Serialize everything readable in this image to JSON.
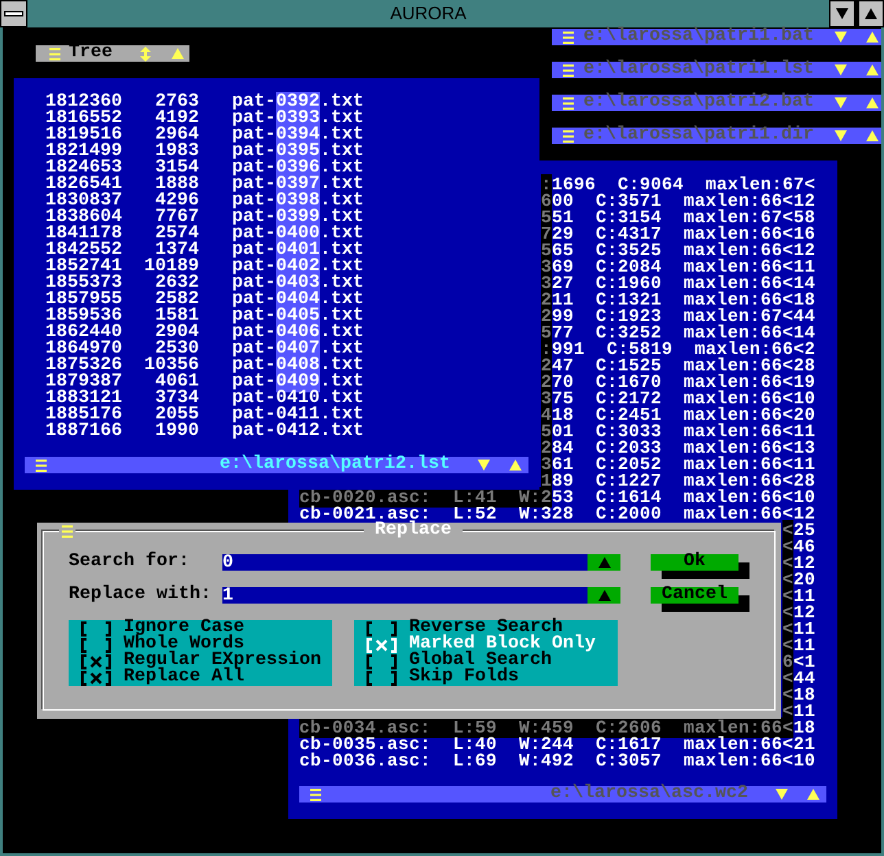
{
  "window": {
    "title": "AURORA"
  },
  "tree_icon": {
    "title": "Tree"
  },
  "minimized_windows": [
    {
      "path": "e:\\larossa\\patri1.bat"
    },
    {
      "path": "e:\\larossa\\patri1.lst"
    },
    {
      "path": "e:\\larossa\\patri2.bat"
    },
    {
      "path": "e:\\larossa\\patri1.dir"
    }
  ],
  "stats_window": {
    "path": "e:\\larossa\\asc.wc2",
    "active": false,
    "rows": [
      {
        "shaded": ":",
        "text": "1696  C:9064  maxlen:67<"
      },
      {
        "shaded": "6",
        "text": "00  C:3571  maxlen:66<12"
      },
      {
        "shaded": "5",
        "text": "51  C:3154  maxlen:67<58"
      },
      {
        "shaded": "7",
        "text": "29  C:4317  maxlen:66<16"
      },
      {
        "shaded": "5",
        "text": "65  C:3525  maxlen:66<12"
      },
      {
        "shaded": "3",
        "text": "69  C:2084  maxlen:66<11"
      },
      {
        "shaded": "3",
        "text": "27  C:1960  maxlen:66<14"
      },
      {
        "shaded": "2",
        "text": "11  C:1321  maxlen:66<18"
      },
      {
        "shaded": "2",
        "text": "99  C:1923  maxlen:67<44"
      },
      {
        "shaded": "5",
        "text": "77  C:3252  maxlen:66<14"
      },
      {
        "shaded": ":",
        "text": "991  C:5819  maxlen:66<2"
      },
      {
        "shaded": "2",
        "text": "47  C:1525  maxlen:66<28"
      },
      {
        "shaded": "2",
        "text": "70  C:1670  maxlen:66<19"
      },
      {
        "shaded": "3",
        "text": "75  C:2172  maxlen:66<10"
      },
      {
        "shaded": "4",
        "text": "18  C:2451  maxlen:66<20"
      },
      {
        "shaded": "5",
        "text": "01  C:3033  maxlen:66<11"
      },
      {
        "shaded": "2",
        "text": "84  C:2033  maxlen:66<13"
      },
      {
        "shaded": "3",
        "text": "61  C:2052  maxlen:66<11"
      },
      {
        "shaded": "1",
        "text": "89  C:1227  maxlen:66<28"
      },
      {
        "shaded": "cb-0020.asc:  L:41  W:2",
        "text": "53  C:1614  maxlen:66<10"
      },
      {
        "text": "cb-0021.asc:  L:52  W:328  C:2000  maxlen:66<12"
      },
      {
        "shaded": "<",
        "text": "25"
      },
      {
        "shaded": "<",
        "text": "46"
      },
      {
        "shaded": "<",
        "text": "12"
      },
      {
        "shaded": "<",
        "text": "20"
      },
      {
        "shaded": "<",
        "text": "11"
      },
      {
        "shaded": "<",
        "text": "12"
      },
      {
        "shaded": "<",
        "text": "11"
      },
      {
        "shaded": "<",
        "text": "11"
      },
      {
        "shaded": "6",
        "text": "<1"
      },
      {
        "shaded": "<",
        "text": "44"
      },
      {
        "shaded": "<",
        "text": "18"
      },
      {
        "shaded": "<",
        "text": "11"
      },
      {
        "shaded": "cb-0034.asc:  L:59  W:459  C:2606  maxlen:66<",
        "text": "18"
      },
      {
        "text": "cb-0035.asc:  L:40  W:244  C:1617  maxlen:66<21"
      },
      {
        "text": "cb-0036.asc:  L:69  W:492  C:3057  maxlen:66<10"
      }
    ]
  },
  "list_window": {
    "path": "e:\\larossa\\patri2.lst",
    "active": true,
    "rows": [
      {
        "number": "1812360",
        "size": "2763",
        "name": [
          "pat-",
          "0392",
          ".txt"
        ],
        "selected": true
      },
      {
        "number": "1816552",
        "size": "4192",
        "name": [
          "pat-",
          "0393",
          ".txt"
        ],
        "selected": true
      },
      {
        "number": "1819516",
        "size": "2964",
        "name": [
          "pat-",
          "0394",
          ".txt"
        ],
        "selected": true
      },
      {
        "number": "1821499",
        "size": "1983",
        "name": [
          "pat-",
          "0395",
          ".txt"
        ],
        "selected": true
      },
      {
        "number": "1824653",
        "size": "3154",
        "name": [
          "pat-",
          "0396",
          ".txt"
        ],
        "selected": true
      },
      {
        "number": "1826541",
        "size": "1888",
        "name": [
          "pat-",
          "0397",
          ".txt"
        ],
        "selected": true
      },
      {
        "number": "1830837",
        "size": "4296",
        "name": [
          "pat-",
          "0398",
          ".txt"
        ],
        "selected": true
      },
      {
        "number": "1838604",
        "size": "7767",
        "name": [
          "pat-",
          "0399",
          ".txt"
        ],
        "selected": true
      },
      {
        "number": "1841178",
        "size": "2574",
        "name": [
          "pat-",
          "0400",
          ".txt"
        ],
        "selected": true
      },
      {
        "number": "1842552",
        "size": "1374",
        "name": [
          "pat-",
          "0401",
          ".txt"
        ],
        "selected": true
      },
      {
        "number": "1852741",
        "size": "10189",
        "name": [
          "pat-",
          "0402",
          ".txt"
        ],
        "selected": true
      },
      {
        "number": "1855373",
        "size": "2632",
        "name": [
          "pat-",
          "0403",
          ".txt"
        ],
        "selected": true
      },
      {
        "number": "1857955",
        "size": "2582",
        "name": [
          "pat-",
          "0404",
          ".txt"
        ],
        "selected": true
      },
      {
        "number": "1859536",
        "size": "1581",
        "name": [
          "pat-",
          "0405",
          ".txt"
        ],
        "selected": true
      },
      {
        "number": "1862440",
        "size": "2904",
        "name": [
          "pat-",
          "0406",
          ".txt"
        ],
        "selected": true
      },
      {
        "number": "1864970",
        "size": "2530",
        "name": [
          "pat-",
          "0407",
          ".txt"
        ],
        "selected": true
      },
      {
        "number": "1875326",
        "size": "10356",
        "name": [
          "pat-",
          "0408",
          ".txt"
        ],
        "selected": true
      },
      {
        "number": "1879387",
        "size": "4061",
        "name": [
          "pat-",
          "0409",
          ".txt"
        ],
        "selected": true
      },
      {
        "number": "1883121",
        "size": "3734",
        "name": [
          "pat-",
          "0410",
          ".txt"
        ],
        "selected": false
      },
      {
        "number": "1885176",
        "size": "2055",
        "name": [
          "pat-",
          "0411",
          ".txt"
        ],
        "selected": false
      },
      {
        "number": "1887166",
        "size": "1990",
        "name": [
          "pat-",
          "0412",
          ".txt"
        ],
        "selected": false
      }
    ]
  },
  "dialog": {
    "title": "Replace",
    "fields": [
      {
        "label": "**S**earch for:",
        "value": "0"
      },
      {
        "label": "Re**p**lace with:",
        "value": "1"
      }
    ],
    "buttons": [
      {
        "label": "O**k**"
      },
      {
        "label": "Cancel"
      }
    ],
    "option_groups": [
      [
        {
          "label": "**I**gnore Case",
          "checked": false,
          "focused": false
        },
        {
          "label": "**W**hole Words",
          "checked": false,
          "focused": false
        },
        {
          "label": "Regular E**X**pression",
          "checked": true,
          "focused": false
        },
        {
          "label": "Replace **A**ll",
          "checked": true,
          "focused": false
        }
      ],
      [
        {
          "label": "**R**everse Search",
          "checked": false,
          "focused": false
        },
        {
          "label": "Marked **B**lock Only",
          "checked": true,
          "focused": true
        },
        {
          "label": "**G**lobal Search",
          "checked": false,
          "focused": false
        },
        {
          "label": "Skip **F**olds",
          "checked": false,
          "focused": false
        }
      ]
    ]
  }
}
